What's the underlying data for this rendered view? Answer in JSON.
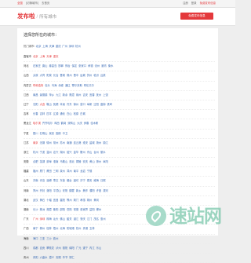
{
  "topbar": {
    "location_label": "全国",
    "switch_label": "[切换城市]",
    "home_label": "去首页",
    "right_items": [
      "注册",
      "登录"
    ],
    "post_label": "免费发布信息"
  },
  "header": {
    "logo_text": "发布啦",
    "separator": "/",
    "subtitle": "所有城市",
    "post_button_label": "免费发布信息"
  },
  "main": {
    "title": "选择您所在的城市：",
    "hot_label": "热门城市:",
    "hot_cities": [
      "北京",
      "上海",
      "天津",
      "重庆",
      "广州",
      "深圳",
      "杭州"
    ],
    "rows": [
      {
        "prov": "直辖市",
        "cities": [
          {
            "name": "北京",
            "red": true
          },
          {
            "name": "上海",
            "red": true
          },
          {
            "name": "天津",
            "red": true
          },
          {
            "name": "重庆",
            "red": true
          }
        ]
      },
      {
        "prov": "河北",
        "cities": [
          {
            "name": "石家庄"
          },
          {
            "name": "唐山"
          },
          {
            "name": "秦皇岛"
          },
          {
            "name": "邯郸"
          },
          {
            "name": "邢台"
          },
          {
            "name": "保定"
          },
          {
            "name": "张家口"
          },
          {
            "name": "承德"
          },
          {
            "name": "沧州"
          },
          {
            "name": "廊坊"
          },
          {
            "name": "衡水"
          }
        ]
      },
      {
        "prov": "山西",
        "cities": [
          {
            "name": "太原"
          },
          {
            "name": "大同"
          },
          {
            "name": "阳泉"
          },
          {
            "name": "长治"
          },
          {
            "name": "晋城"
          },
          {
            "name": "朔州"
          },
          {
            "name": "晋中"
          },
          {
            "name": "运城"
          },
          {
            "name": "忻州"
          },
          {
            "name": "临汾"
          },
          {
            "name": "吕梁"
          }
        ]
      },
      {
        "prov": "内蒙古",
        "cities": [
          {
            "name": "呼和浩特",
            "red": true
          },
          {
            "name": "包头"
          },
          {
            "name": "乌海"
          },
          {
            "name": "赤峰"
          },
          {
            "name": "通辽"
          },
          {
            "name": "鄂尔多斯"
          },
          {
            "name": "呼伦贝尔"
          }
        ]
      },
      {
        "prov": "江西",
        "cities": [
          {
            "name": "南昌"
          },
          {
            "name": "景德镇"
          },
          {
            "name": "萍乡"
          },
          {
            "name": "九江"
          },
          {
            "name": "新余"
          },
          {
            "name": "鹰潭"
          },
          {
            "name": "赣州"
          },
          {
            "name": "吉安"
          },
          {
            "name": "宜春"
          },
          {
            "name": "抚州"
          },
          {
            "name": "上饶"
          }
        ]
      },
      {
        "prov": "辽宁",
        "cities": [
          {
            "name": "沈阳"
          },
          {
            "name": "大连",
            "red": true
          },
          {
            "name": "鞍山"
          },
          {
            "name": "抚顺"
          },
          {
            "name": "本溪"
          },
          {
            "name": "丹东"
          },
          {
            "name": "锦州"
          },
          {
            "name": "营口"
          },
          {
            "name": "阜新"
          },
          {
            "name": "辽阳"
          },
          {
            "name": "盘锦"
          },
          {
            "name": "铁岭"
          }
        ]
      },
      {
        "prov": "吉林",
        "cities": [
          {
            "name": "长春"
          },
          {
            "name": "吉林"
          },
          {
            "name": "四平"
          },
          {
            "name": "辽源"
          },
          {
            "name": "通化"
          },
          {
            "name": "白山"
          },
          {
            "name": "松原"
          },
          {
            "name": "白城"
          }
        ]
      },
      {
        "prov": "黑龙江",
        "cities": [
          {
            "name": "哈尔滨",
            "red": true
          },
          {
            "name": "齐齐哈尔"
          },
          {
            "name": "鸡西"
          },
          {
            "name": "鹤岗"
          },
          {
            "name": "双鸭山"
          },
          {
            "name": "大庆"
          },
          {
            "name": "伊春"
          },
          {
            "name": "佳木斯"
          }
        ]
      },
      {
        "prov": "宁夏",
        "cities": [
          {
            "name": "银川"
          },
          {
            "name": "石嘴山"
          },
          {
            "name": "吴忠"
          },
          {
            "name": "固原"
          },
          {
            "name": "中卫"
          }
        ]
      },
      {
        "prov": "江苏",
        "cities": [
          {
            "name": "南京",
            "red": true
          },
          {
            "name": "无锡"
          },
          {
            "name": "徐州"
          },
          {
            "name": "常州"
          },
          {
            "name": "苏州"
          },
          {
            "name": "南通"
          },
          {
            "name": "连云港"
          },
          {
            "name": "淮安"
          },
          {
            "name": "盐城"
          },
          {
            "name": "扬州"
          },
          {
            "name": "镇江"
          }
        ]
      },
      {
        "prov": "浙江",
        "cities": [
          {
            "name": "杭州"
          },
          {
            "name": "宁波"
          },
          {
            "name": "温州"
          },
          {
            "name": "嘉兴"
          },
          {
            "name": "湖州"
          },
          {
            "name": "绍兴"
          },
          {
            "name": "金华"
          },
          {
            "name": "衢州"
          },
          {
            "name": "舟山"
          },
          {
            "name": "台州"
          },
          {
            "name": "丽水"
          }
        ]
      },
      {
        "prov": "安徽",
        "cities": [
          {
            "name": "合肥"
          },
          {
            "name": "芜湖"
          },
          {
            "name": "蚌埠"
          },
          {
            "name": "淮南"
          },
          {
            "name": "马鞍山"
          },
          {
            "name": "淮北"
          },
          {
            "name": "铜陵"
          },
          {
            "name": "安庆"
          },
          {
            "name": "黄山"
          },
          {
            "name": "滁州"
          },
          {
            "name": "阜阳"
          }
        ]
      },
      {
        "prov": "福建",
        "cities": [
          {
            "name": "福州"
          },
          {
            "name": "厦门"
          },
          {
            "name": "莆田"
          },
          {
            "name": "三明"
          },
          {
            "name": "泉州"
          },
          {
            "name": "漳州"
          },
          {
            "name": "南平"
          },
          {
            "name": "龙岩"
          },
          {
            "name": "宁德"
          }
        ]
      },
      {
        "prov": "山东",
        "cities": [
          {
            "name": "济南"
          },
          {
            "name": "青岛"
          },
          {
            "name": "淄博"
          },
          {
            "name": "枣庄"
          },
          {
            "name": "东营"
          },
          {
            "name": "烟台"
          },
          {
            "name": "潍坊"
          },
          {
            "name": "济宁"
          },
          {
            "name": "泰安"
          },
          {
            "name": "威海"
          },
          {
            "name": "日照"
          }
        ]
      },
      {
        "prov": "河南",
        "cities": [
          {
            "name": "郑州"
          },
          {
            "name": "开封"
          },
          {
            "name": "洛阳"
          },
          {
            "name": "平顶山"
          },
          {
            "name": "安阳"
          },
          {
            "name": "鹤壁"
          },
          {
            "name": "新乡"
          },
          {
            "name": "焦作"
          },
          {
            "name": "濮阳"
          },
          {
            "name": "许昌"
          },
          {
            "name": "漯河"
          }
        ]
      },
      {
        "prov": "湖北",
        "cities": [
          {
            "name": "武汉"
          },
          {
            "name": "黄石"
          },
          {
            "name": "十堰"
          },
          {
            "name": "宜昌"
          },
          {
            "name": "襄阳"
          },
          {
            "name": "鄂州"
          },
          {
            "name": "荆门"
          },
          {
            "name": "孝感"
          },
          {
            "name": "荆州"
          },
          {
            "name": "黄冈"
          }
        ]
      },
      {
        "prov": "湖南",
        "cities": [
          {
            "name": "长沙"
          },
          {
            "name": "株洲"
          },
          {
            "name": "湘潭"
          },
          {
            "name": "衡阳"
          },
          {
            "name": "邵阳"
          },
          {
            "name": "岳阳"
          },
          {
            "name": "常德"
          },
          {
            "name": "张家界"
          },
          {
            "name": "益阳"
          },
          {
            "name": "郴州"
          }
        ]
      },
      {
        "prov": "广东",
        "cities": [
          {
            "name": "广州",
            "red": true
          },
          {
            "name": "深圳",
            "red": true
          },
          {
            "name": "珠海"
          },
          {
            "name": "汕头"
          },
          {
            "name": "佛山"
          },
          {
            "name": "韶关"
          },
          {
            "name": "湛江"
          },
          {
            "name": "肇庆"
          },
          {
            "name": "江门"
          },
          {
            "name": "茂名"
          },
          {
            "name": "惠州"
          }
        ]
      },
      {
        "prov": "广西",
        "cities": [
          {
            "name": "南宁"
          },
          {
            "name": "柳州"
          },
          {
            "name": "桂林"
          },
          {
            "name": "梧州"
          },
          {
            "name": "北海"
          },
          {
            "name": "防城港"
          },
          {
            "name": "钦州"
          },
          {
            "name": "贵港"
          },
          {
            "name": "玉林"
          }
        ]
      },
      {
        "prov": "海南",
        "cities": [
          {
            "name": "海口"
          },
          {
            "name": "三亚"
          },
          {
            "name": "三沙"
          },
          {
            "name": "儋州"
          }
        ]
      },
      {
        "prov": "四川",
        "cities": [
          {
            "name": "成都"
          },
          {
            "name": "自贡"
          },
          {
            "name": "攀枝花"
          },
          {
            "name": "泸州"
          },
          {
            "name": "德阳"
          },
          {
            "name": "绵阳"
          },
          {
            "name": "广元"
          },
          {
            "name": "遂宁"
          },
          {
            "name": "内江"
          },
          {
            "name": "乐山"
          }
        ]
      },
      {
        "prov": "贵州",
        "cities": [
          {
            "name": "贵阳"
          },
          {
            "name": "六盘水"
          },
          {
            "name": "遵义"
          },
          {
            "name": "安顺"
          },
          {
            "name": "毕节"
          },
          {
            "name": "铜仁"
          }
        ]
      }
    ]
  },
  "watermark": {
    "text": "速站网"
  }
}
